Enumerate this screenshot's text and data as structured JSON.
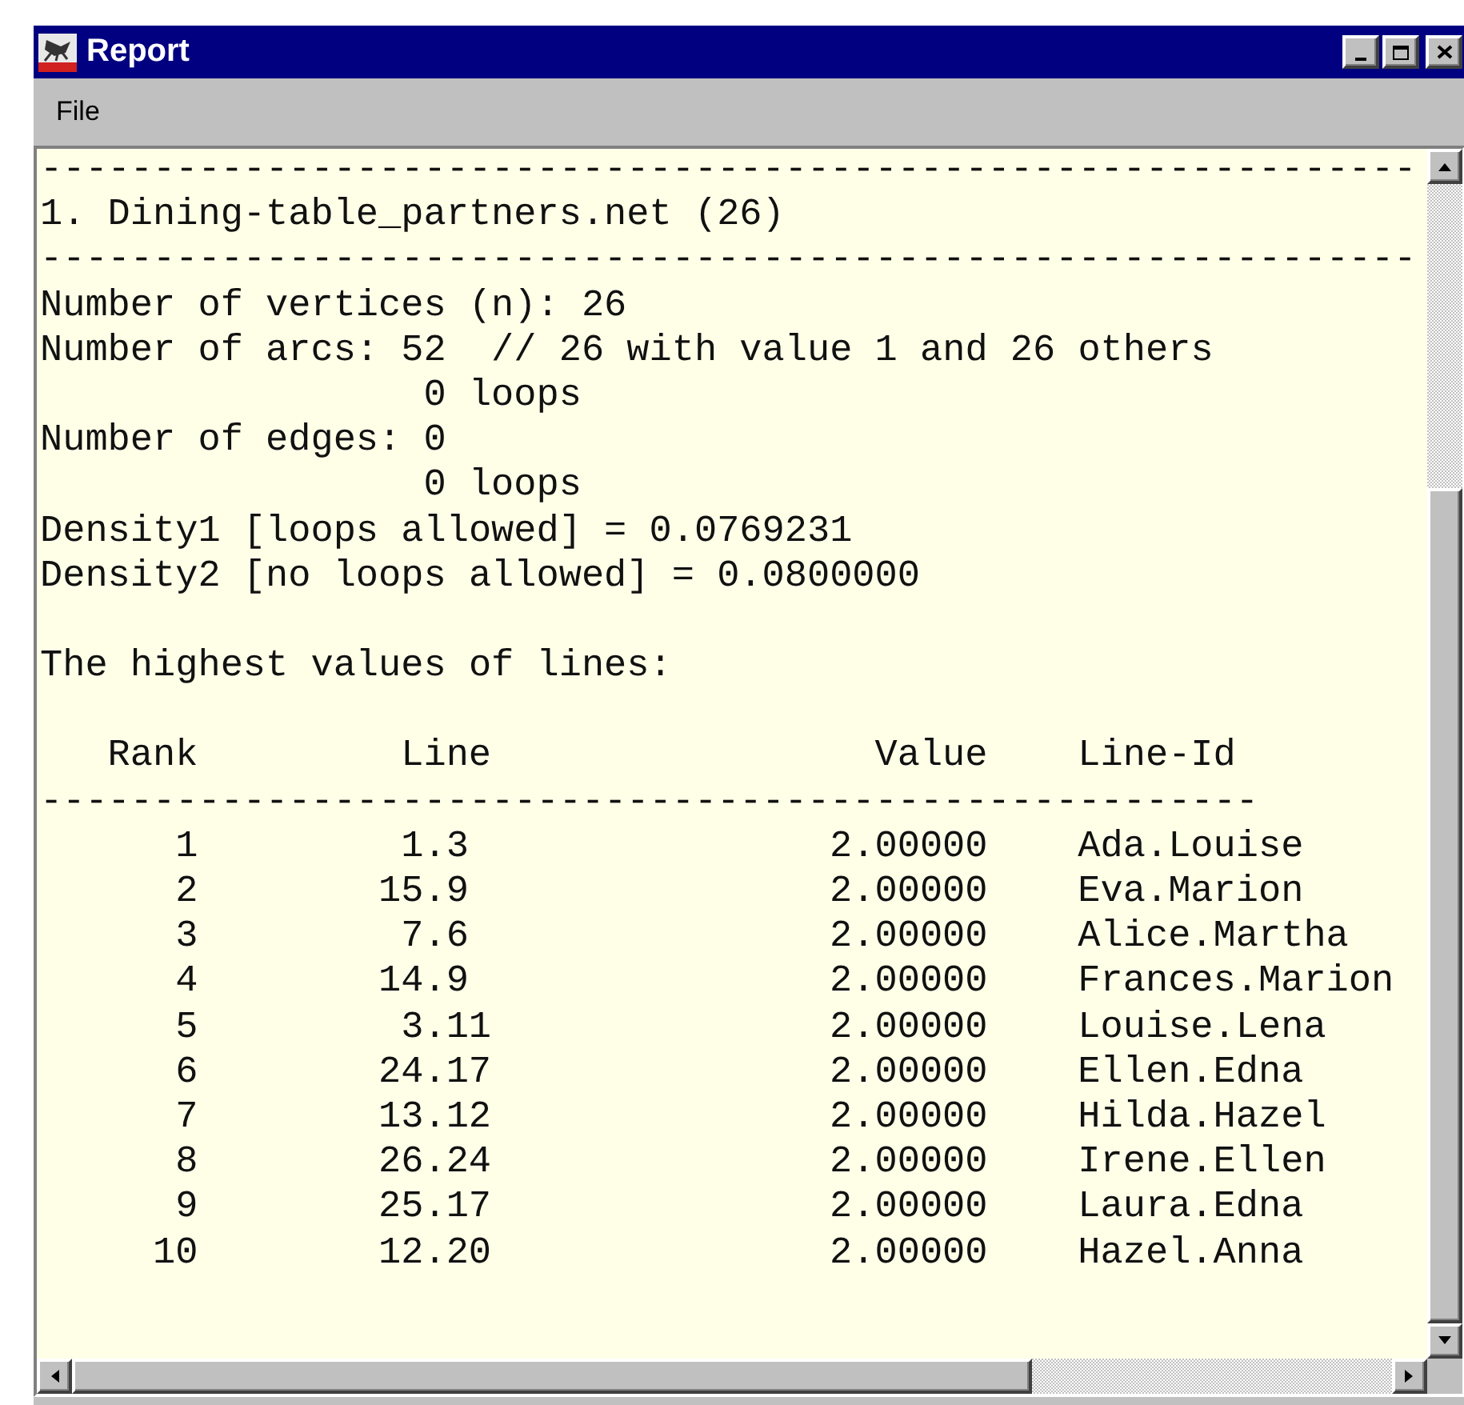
{
  "window": {
    "title": "Report"
  },
  "menu": [
    {
      "label": "File"
    }
  ],
  "report": {
    "header": {
      "top_rule": "-------------------------------------------------------------",
      "title": "1. Dining-table_partners.net (26)",
      "bottom_rule": "-------------------------------------------------------------"
    },
    "stats": [
      {
        "kind": "text",
        "text": "Number of vertices (n): 26"
      },
      {
        "kind": "text",
        "text": "Number of arcs: 52  // 26 with value 1 and 26 others"
      },
      {
        "kind": "continuation",
        "text": "0 loops"
      },
      {
        "kind": "text",
        "text": "Number of edges: 0"
      },
      {
        "kind": "continuation",
        "text": "0 loops"
      },
      {
        "kind": "text",
        "text": "Density1 [loops allowed] = 0.0769231"
      },
      {
        "kind": "text",
        "text": "Density2 [no loops allowed] = 0.0800000"
      }
    ],
    "table_title": "The highest values of lines:",
    "table": {
      "columns": [
        "Rank",
        "Line",
        "Value",
        "Line-Id"
      ],
      "rule": "------------------------------------------------------",
      "rows": [
        {
          "rank": "1",
          "line": "1.3",
          "value": "2.00000",
          "line_id": "Ada.Louise"
        },
        {
          "rank": "2",
          "line": "15.9",
          "value": "2.00000",
          "line_id": "Eva.Marion"
        },
        {
          "rank": "3",
          "line": "7.6",
          "value": "2.00000",
          "line_id": "Alice.Martha"
        },
        {
          "rank": "4",
          "line": "14.9",
          "value": "2.00000",
          "line_id": "Frances.Marion"
        },
        {
          "rank": "5",
          "line": "3.11",
          "value": "2.00000",
          "line_id": "Louise.Lena"
        },
        {
          "rank": "6",
          "line": "24.17",
          "value": "2.00000",
          "line_id": "Ellen.Edna"
        },
        {
          "rank": "7",
          "line": "13.12",
          "value": "2.00000",
          "line_id": "Hilda.Hazel"
        },
        {
          "rank": "8",
          "line": "26.24",
          "value": "2.00000",
          "line_id": "Irene.Ellen"
        },
        {
          "rank": "9",
          "line": "25.17",
          "value": "2.00000",
          "line_id": "Laura.Edna"
        },
        {
          "rank": "10",
          "line": "12.20",
          "value": "2.00000",
          "line_id": "Hazel.Anna"
        }
      ]
    }
  }
}
